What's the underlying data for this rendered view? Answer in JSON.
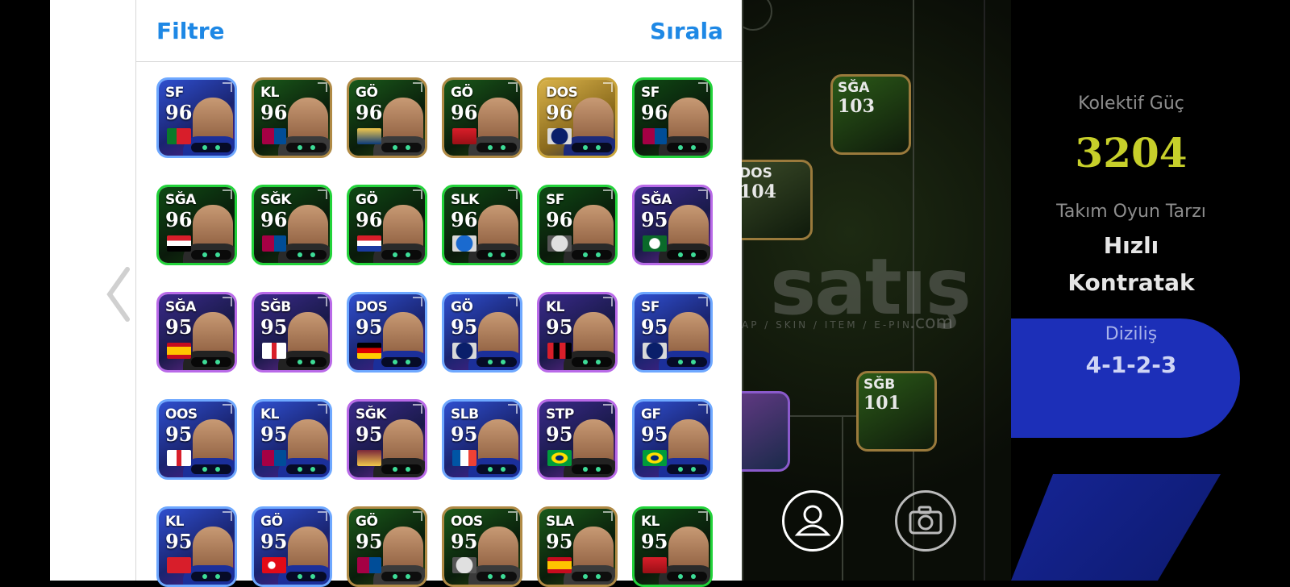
{
  "header": {
    "filter_label": "Filtre",
    "sort_label": "Sırala"
  },
  "players": [
    {
      "pos": "SF",
      "rating": "96",
      "theme": "blue",
      "flag": "portugal"
    },
    {
      "pos": "KL",
      "rating": "96",
      "theme": "green-gold",
      "flag": "barcelona"
    },
    {
      "pos": "GÖ",
      "rating": "96",
      "theme": "green-gold",
      "flag": "la-galaxy"
    },
    {
      "pos": "GÖ",
      "rating": "96",
      "theme": "green-gold",
      "flag": "arsenal"
    },
    {
      "pos": "DOS",
      "rating": "96",
      "theme": "gold",
      "flag": "inter"
    },
    {
      "pos": "SF",
      "rating": "96",
      "theme": "green",
      "flag": "barcelona"
    },
    {
      "pos": "SĞA",
      "rating": "96",
      "theme": "green",
      "flag": "egypt"
    },
    {
      "pos": "SĞK",
      "rating": "96",
      "theme": "green",
      "flag": "barcelona"
    },
    {
      "pos": "GÖ",
      "rating": "96",
      "theme": "green",
      "flag": "croatia"
    },
    {
      "pos": "SLK",
      "rating": "96",
      "theme": "green",
      "flag": "mgm"
    },
    {
      "pos": "SF",
      "rating": "96",
      "theme": "green",
      "flag": "club-crest"
    },
    {
      "pos": "SĞA",
      "rating": "95",
      "theme": "purple",
      "flag": "palmeiras"
    },
    {
      "pos": "SĞA",
      "rating": "95",
      "theme": "purple",
      "flag": "spain"
    },
    {
      "pos": "SĞB",
      "rating": "95",
      "theme": "purple",
      "flag": "england"
    },
    {
      "pos": "DOS",
      "rating": "95",
      "theme": "blue",
      "flag": "germany"
    },
    {
      "pos": "GÖ",
      "rating": "95",
      "theme": "blue",
      "flag": "inter"
    },
    {
      "pos": "KL",
      "rating": "95",
      "theme": "purple",
      "flag": "milan"
    },
    {
      "pos": "SF",
      "rating": "95",
      "theme": "blue",
      "flag": "inter"
    },
    {
      "pos": "OOS",
      "rating": "95",
      "theme": "blue",
      "flag": "england"
    },
    {
      "pos": "KL",
      "rating": "95",
      "theme": "blue",
      "flag": "barcelona"
    },
    {
      "pos": "SĞK",
      "rating": "95",
      "theme": "purple",
      "flag": "west-ham"
    },
    {
      "pos": "SLB",
      "rating": "95",
      "theme": "blue",
      "flag": "france"
    },
    {
      "pos": "STP",
      "rating": "95",
      "theme": "purple",
      "flag": "brazil"
    },
    {
      "pos": "GF",
      "rating": "95",
      "theme": "blue",
      "flag": "brazil"
    },
    {
      "pos": "KL",
      "rating": "95",
      "theme": "blue",
      "flag": "switzerland"
    },
    {
      "pos": "GÖ",
      "rating": "95",
      "theme": "blue",
      "flag": "turkey"
    },
    {
      "pos": "GÖ",
      "rating": "95",
      "theme": "green-gold",
      "flag": "barcelona"
    },
    {
      "pos": "OOS",
      "rating": "95",
      "theme": "green-gold",
      "flag": "club-crest"
    },
    {
      "pos": "SLA",
      "rating": "95",
      "theme": "green-gold",
      "flag": "spain"
    },
    {
      "pos": "KL",
      "rating": "95",
      "theme": "green",
      "flag": "arsenal"
    }
  ],
  "pitch": {
    "cards": [
      {
        "pos": "SĞA",
        "rating": "103"
      },
      {
        "pos": "DOS",
        "rating": "104"
      },
      {
        "pos": "SĞB",
        "rating": "101"
      }
    ],
    "watermark": "satış",
    "watermark_sub": "AP / SKIN / ITEM / E-PIN",
    "watermark_com": ".com"
  },
  "sidebar": {
    "power_label": "Kolektif Güç",
    "power_value": "3204",
    "style_label": "Takım Oyun Tarzı",
    "style_value_1": "Hızlı",
    "style_value_2": "Kontratak",
    "formation_label": "Diziliş",
    "formation_value": "4-1-2-3"
  },
  "colors": {
    "accent": "#1e88e5",
    "power": "#c7cf2a",
    "blue_shape": "#1c2fb8"
  }
}
